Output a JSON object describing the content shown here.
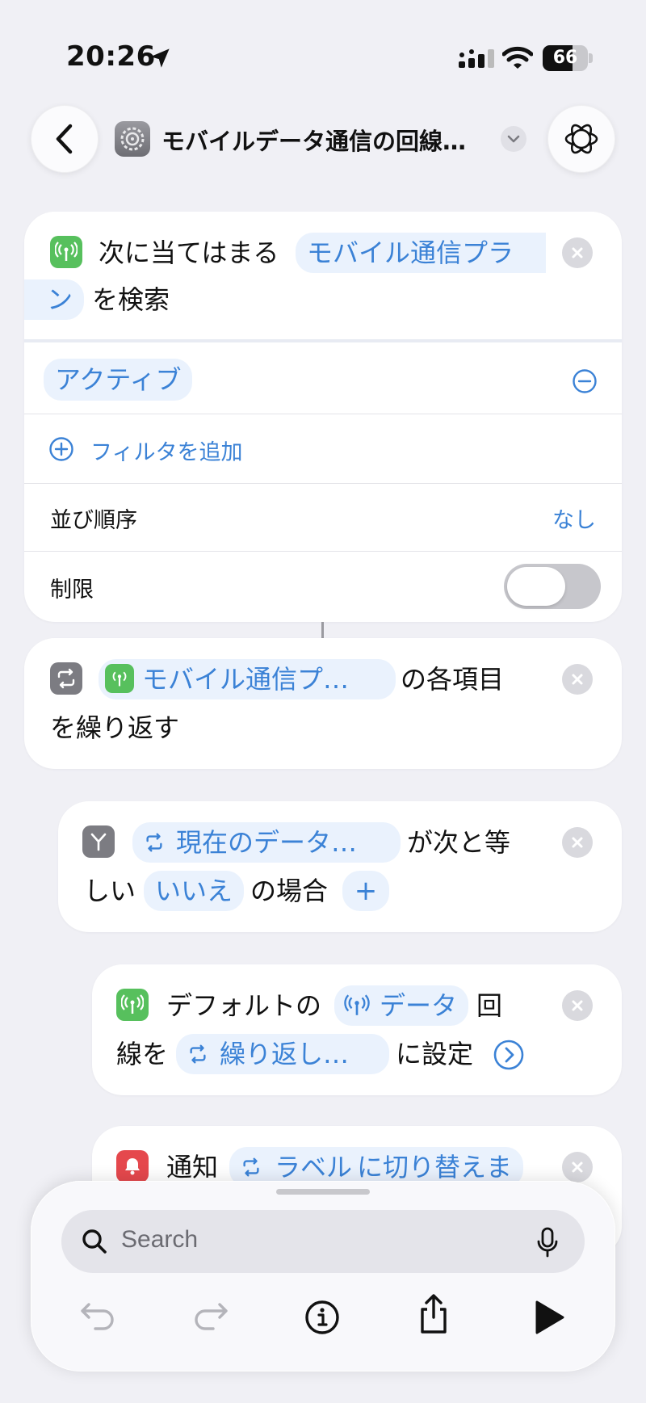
{
  "status_bar": {
    "time": "20:26",
    "battery": "66",
    "battery_level": 0.66
  },
  "header": {
    "title": "モバイルデータ通信の回線…"
  },
  "find_action": {
    "prefix": "次に当てはまる",
    "param_part1": "モバイル通信プラ",
    "param_part2": "ン",
    "suffix": "を検索",
    "filter_value": "アクティブ",
    "add_filter_label": "フィルタを追加",
    "sort_label": "並び順序",
    "sort_value": "なし",
    "limit_label": "制限",
    "limit_enabled": false
  },
  "repeat_action": {
    "variable": "モバイル通信プ…",
    "suffix1": "の各項目",
    "line2": "を繰り返す"
  },
  "if_action": {
    "variable": "現在のデータ…",
    "text1": "が次と等",
    "text2": "しい",
    "value": "いいえ",
    "text3": "の場合",
    "plus": "+"
  },
  "set_action": {
    "text1": "デフォルトの",
    "param": "データ",
    "text2": "回",
    "text3": "線を",
    "variable": "繰り返し…",
    "text4": "に設定"
  },
  "notify_action": {
    "label": "通知",
    "variable": "ラベル",
    "text": "に切り替えま"
  },
  "bottom_bar": {
    "search_placeholder": "Search"
  },
  "colors": {
    "accent": "#3b82d6",
    "green": "#57c05d",
    "red": "#e5484d",
    "background": "#f0f0f5"
  }
}
